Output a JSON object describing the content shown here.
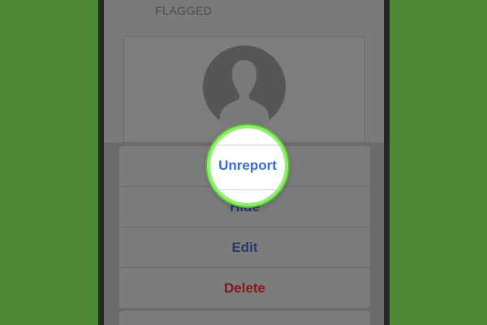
{
  "header": {
    "flagged_label": "FLAGGED"
  },
  "profile": {
    "avatar_icon": "person-silhouette-icon"
  },
  "action_sheet": {
    "items": [
      {
        "label": "Unreport",
        "style": "default"
      },
      {
        "label": "Hide",
        "style": "default"
      },
      {
        "label": "Edit",
        "style": "default"
      },
      {
        "label": "Delete",
        "style": "destructive"
      }
    ]
  },
  "highlight": {
    "label": "Unreport"
  },
  "colors": {
    "background": "#4e8a36",
    "action_text": "#243a6e",
    "destructive_text": "#8a1418",
    "highlight_ring": "#8ef06a",
    "highlight_text": "#3a6bd4"
  }
}
